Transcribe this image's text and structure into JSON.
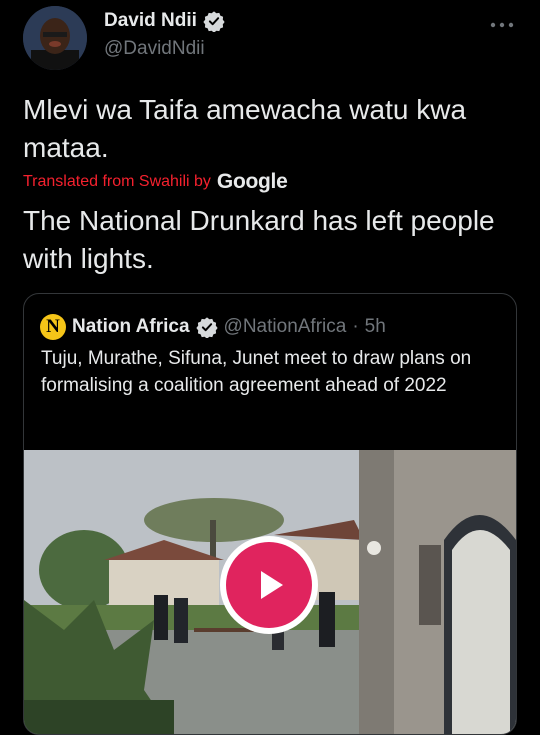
{
  "author": {
    "name": "David Ndii",
    "handle": "@DavidNdii"
  },
  "tweet": {
    "text": "Mlevi wa Taifa amewacha watu kwa mataa.",
    "translated_label": "Translated from Swahili by",
    "translator": "Google",
    "translation": "The National Drunkard has left people with lights."
  },
  "quoted": {
    "logo_letter": "N",
    "name": "Nation Africa",
    "handle": "@NationAfrica",
    "separator": "·",
    "time": "5h",
    "text": "Tuju, Murathe, Sifuna, Junet meet to draw plans on formalising a coalition agreement ahead of 2022"
  },
  "icons": {
    "verified": "verified-badge-icon",
    "more": "more-options-icon",
    "play": "play-icon"
  },
  "colors": {
    "background": "#000000",
    "text": "#e7e9ea",
    "muted": "#71767b",
    "translated": "#f4212e",
    "play": "#e0245e",
    "logo": "#f5c518"
  }
}
